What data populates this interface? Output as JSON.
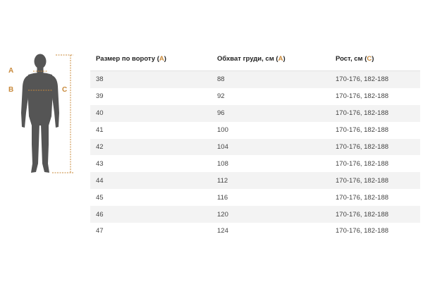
{
  "figure": {
    "labels": {
      "a": "A",
      "b": "B",
      "c": "C"
    },
    "accent_color": "#c8893a",
    "body_color": "#555555"
  },
  "table": {
    "headers": [
      {
        "text": "Размер по вороту ",
        "letter": "A"
      },
      {
        "text": "Обхват груди, см ",
        "letter": "A"
      },
      {
        "text": "Рост, см ",
        "letter": "C"
      }
    ],
    "rows": [
      [
        "38",
        "88",
        "170-176, 182-188"
      ],
      [
        "39",
        "92",
        "170-176, 182-188"
      ],
      [
        "40",
        "96",
        "170-176, 182-188"
      ],
      [
        "41",
        "100",
        "170-176, 182-188"
      ],
      [
        "42",
        "104",
        "170-176, 182-188"
      ],
      [
        "43",
        "108",
        "170-176, 182-188"
      ],
      [
        "44",
        "112",
        "170-176, 182-188"
      ],
      [
        "45",
        "116",
        "170-176, 182-188"
      ],
      [
        "46",
        "120",
        "170-176, 182-188"
      ],
      [
        "47",
        "124",
        "170-176, 182-188"
      ]
    ]
  }
}
